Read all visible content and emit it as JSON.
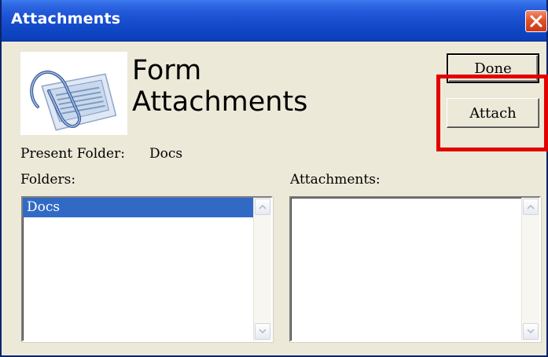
{
  "window": {
    "title": "Attachments"
  },
  "header": {
    "title_line1": "Form",
    "title_line2": "Attachments"
  },
  "buttons": {
    "done_label": "Done",
    "attach_label": "Attach"
  },
  "present_folder": {
    "label": "Present Folder:",
    "value": "Docs"
  },
  "folders": {
    "label": "Folders:",
    "items": [
      {
        "label": "Docs",
        "selected": true
      }
    ]
  },
  "attachments": {
    "label": "Attachments:",
    "items": []
  },
  "icons": {
    "close": "close-icon",
    "form_attachments": "paperclip-document-icon",
    "scroll_up": "scroll-up-arrow-icon",
    "scroll_down": "scroll-down-arrow-icon"
  },
  "colors": {
    "titlebar": "#0a3fb8",
    "window_bg": "#ece9d8",
    "selection": "#316ac5",
    "highlight": "#e30000"
  }
}
